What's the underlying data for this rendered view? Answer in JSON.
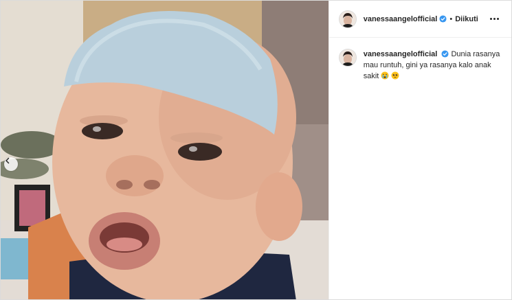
{
  "post": {
    "author": {
      "username": "vanessaangelofficial",
      "verified": true,
      "follow_status": "Diikuti"
    },
    "separator": "•",
    "caption": {
      "text": "Dunia rasanya mau runtuh, gini ya rasanya kalo anak sakit",
      "emojis": [
        "crying-face",
        "pleading-face"
      ]
    },
    "media": {
      "carousel_prev_icon": "chevron-left-icon"
    }
  },
  "colors": {
    "verified_blue": "#3897f0",
    "text": "#262626",
    "border": "#dbdbdb"
  }
}
